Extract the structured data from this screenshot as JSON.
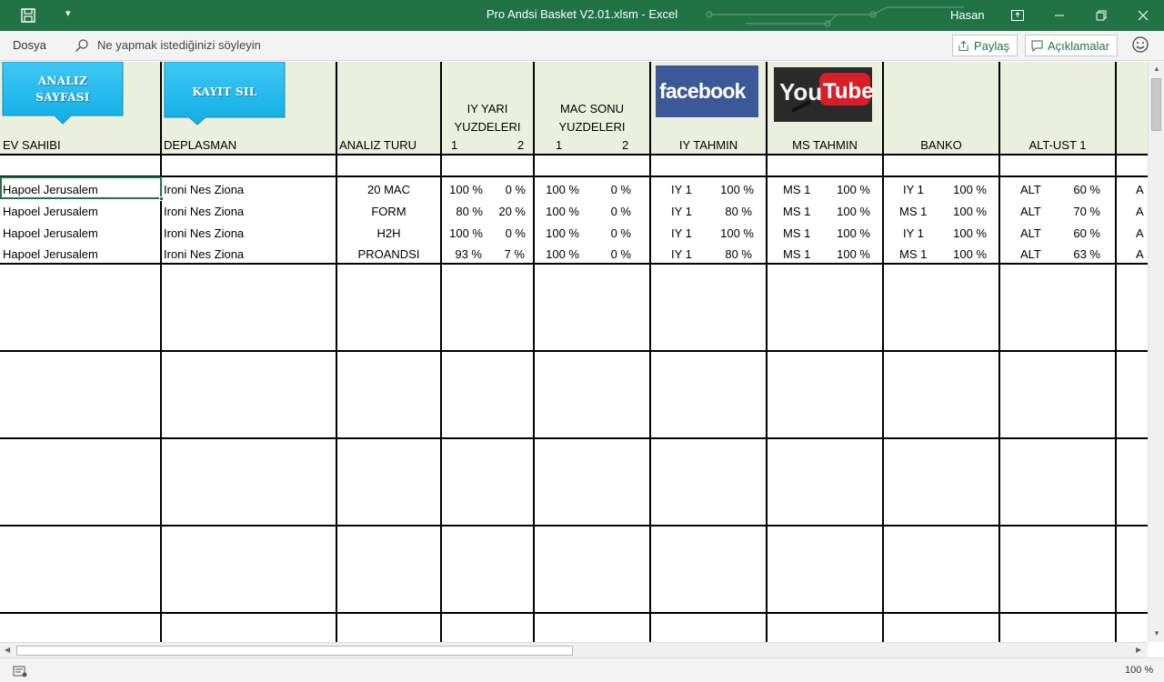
{
  "window": {
    "title": "Pro Andsi Basket V2.01.xlsm  -  Excel",
    "user": "Hasan",
    "accent": "#217346"
  },
  "commands": {
    "file_tab": "Dosya",
    "tell_me": "Ne yapmak istediğinizi söyleyin",
    "share": "Paylaş",
    "comments": "Açıklamalar"
  },
  "buttons": {
    "analysis": "ANALIZ SAYFASI",
    "delete_record": "KAYIT SIL"
  },
  "logos": {
    "facebook": "facebook",
    "youtube_you": "You",
    "youtube_tube": "Tube"
  },
  "headers": {
    "home": "EV SAHIBI",
    "away": "DEPLASMAN",
    "analysis_type": "ANALIZ TURU",
    "iy_yari_line1": "IY YARI",
    "iy_yari_line2": "YUZDELERI",
    "mac_sonu_line1": "MAC SONU",
    "mac_sonu_line2": "YUZDELERI",
    "sub1": "1",
    "sub2": "2",
    "iy_tahmin": "IY TAHMIN",
    "ms_tahmin": "MS TAHMIN",
    "banko": "BANKO",
    "alt_ust": "ALT-UST 1"
  },
  "rows": [
    {
      "home": "Hapoel Jerusalem",
      "away": "Ironi Nes Ziona",
      "type": "20 MAC",
      "iy1": "100 %",
      "iy2": "0 %",
      "ms1": "100 %",
      "ms2": "0 %",
      "iyt": "IY 1",
      "iyt_pct": "100 %",
      "mst": "MS 1",
      "mst_pct": "100 %",
      "banko": "IY 1",
      "banko_pct": "100 %",
      "au": "ALT",
      "au_pct": "60 %",
      "next": "A"
    },
    {
      "home": "Hapoel Jerusalem",
      "away": "Ironi Nes Ziona",
      "type": "FORM",
      "iy1": "80 %",
      "iy2": "20 %",
      "ms1": "100 %",
      "ms2": "0 %",
      "iyt": "IY 1",
      "iyt_pct": "80 %",
      "mst": "MS 1",
      "mst_pct": "100 %",
      "banko": "MS 1",
      "banko_pct": "100 %",
      "au": "ALT",
      "au_pct": "70 %",
      "next": "A"
    },
    {
      "home": "Hapoel Jerusalem",
      "away": "Ironi Nes Ziona",
      "type": "H2H",
      "iy1": "100 %",
      "iy2": "0 %",
      "ms1": "100 %",
      "ms2": "0 %",
      "iyt": "IY 1",
      "iyt_pct": "100 %",
      "mst": "MS 1",
      "mst_pct": "100 %",
      "banko": "IY 1",
      "banko_pct": "100 %",
      "au": "ALT",
      "au_pct": "60 %",
      "next": "A"
    },
    {
      "home": "Hapoel Jerusalem",
      "away": "Ironi Nes Ziona",
      "type": "PROANDSI",
      "iy1": "93 %",
      "iy2": "7 %",
      "ms1": "100 %",
      "ms2": "0 %",
      "iyt": "IY 1",
      "iyt_pct": "80 %",
      "mst": "MS 1",
      "mst_pct": "100 %",
      "banko": "MS 1",
      "banko_pct": "100 %",
      "au": "ALT",
      "au_pct": "63 %",
      "next": "A"
    }
  ],
  "status": {
    "zoom": "100 %"
  }
}
